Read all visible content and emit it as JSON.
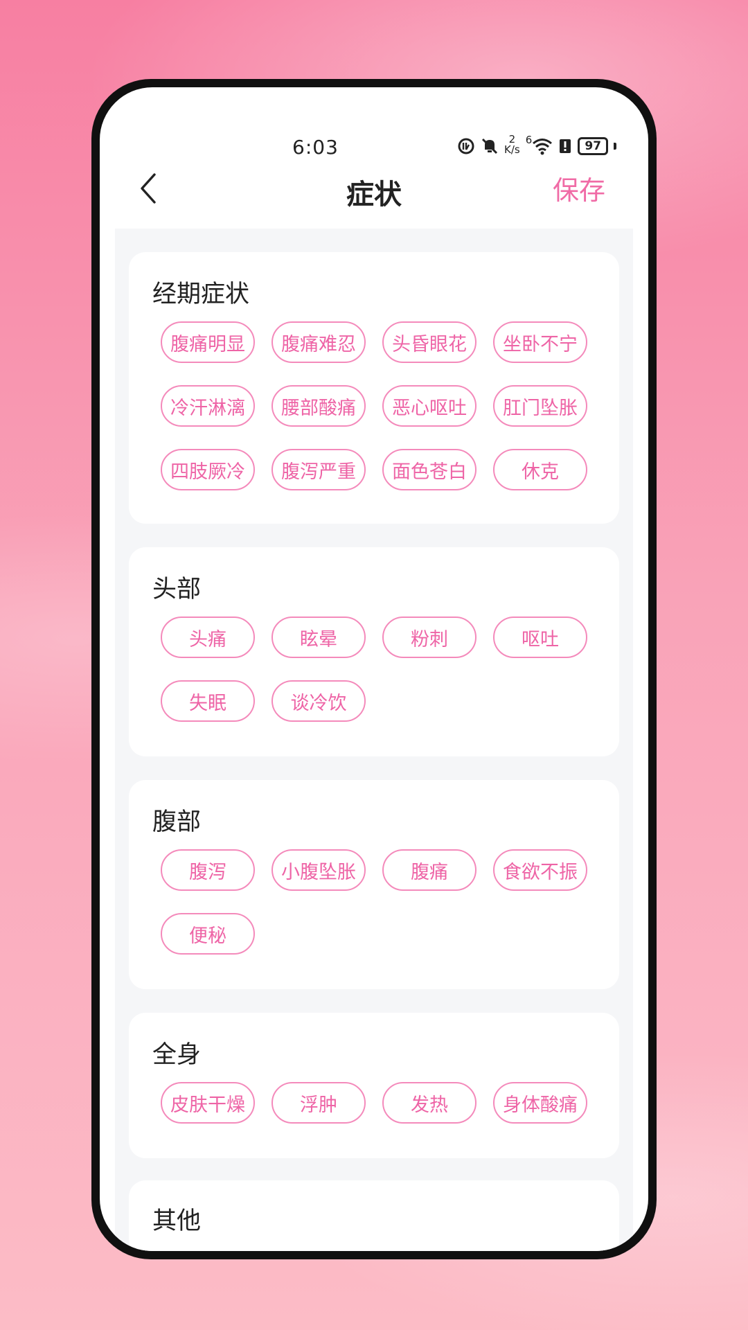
{
  "status_bar": {
    "time": "6:03",
    "net_speed_top": "2",
    "net_speed_unit": "K/s",
    "wifi_sup": "6",
    "battery": "97"
  },
  "header": {
    "title": "症状",
    "save_label": "保存"
  },
  "sections": [
    {
      "title": "经期症状",
      "tags": [
        "腹痛明显",
        "腹痛难忍",
        "头昏眼花",
        "坐卧不宁",
        "冷汗淋漓",
        "腰部酸痛",
        "恶心呕吐",
        "肛门坠胀",
        "四肢厥冷",
        "腹泻严重",
        "面色苍白",
        "休克"
      ]
    },
    {
      "title": "头部",
      "tags": [
        "头痛",
        "眩晕",
        "粉刺",
        "呕吐",
        "失眠",
        "谈冷饮"
      ]
    },
    {
      "title": "腹部",
      "tags": [
        "腹泻",
        "小腹坠胀",
        "腹痛",
        "食欲不振",
        "便秘"
      ]
    },
    {
      "title": "全身",
      "tags": [
        "皮肤干燥",
        "浮肿",
        "发热",
        "身体酸痛"
      ]
    },
    {
      "title": "其他",
      "tags": []
    }
  ],
  "colors": {
    "accent": "#f06ba6",
    "tag_border": "#f48abb",
    "tag_text": "#ee64a6"
  }
}
